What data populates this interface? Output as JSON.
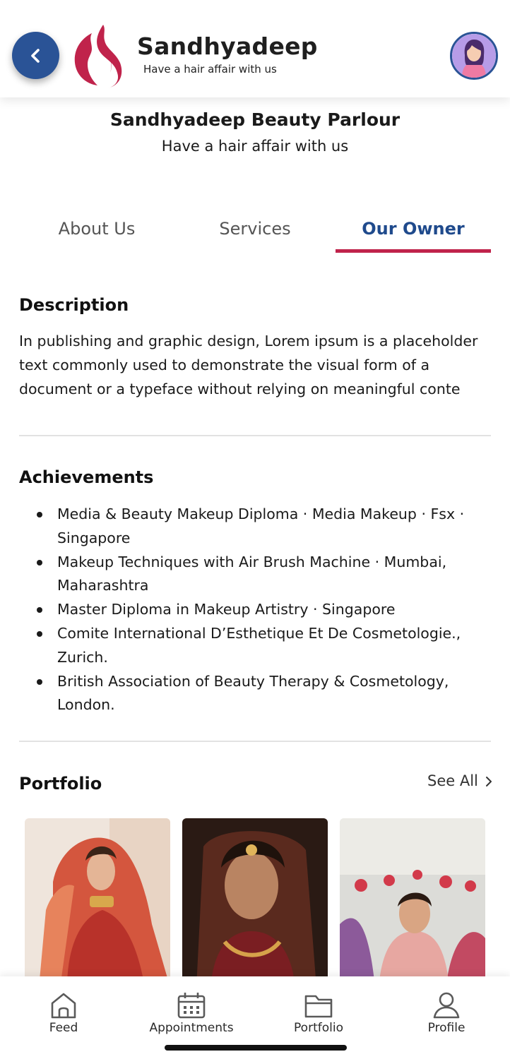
{
  "header": {
    "brand_name": "Sandhyadeep",
    "brand_tagline": "Have a hair affair with us",
    "accent_color": "#2a5396",
    "logo_color": "#c0234b"
  },
  "parlour": {
    "title": "Sandhyadeep Beauty Parlour",
    "subtitle": "Have a hair affair with us"
  },
  "tabs": [
    {
      "label": "About Us",
      "active": false
    },
    {
      "label": "Services",
      "active": false
    },
    {
      "label": "Our Owner",
      "active": true
    }
  ],
  "description": {
    "heading": "Description",
    "text": "In publishing and graphic design, Lorem ipsum is a placeholder text commonly used to demonstrate the visual form of a document or a typeface without relying on meaningful conte"
  },
  "achievements": {
    "heading": "Achievements",
    "items": [
      "Media & Beauty Makeup Diploma · Media Makeup · Fsx · Singapore",
      "Makeup Techniques with Air Brush Machine · Mumbai, Maharashtra",
      "Master Diploma in Makeup Artistry · Singapore",
      "Comite International D’Esthetique Et De Cosmetologie., Zurich.",
      "British Association of Beauty Therapy & Cosmetology, London."
    ]
  },
  "portfolio": {
    "heading": "Portfolio",
    "see_all": "See All"
  },
  "bottom_nav": [
    {
      "label": "Feed",
      "icon": "home-icon"
    },
    {
      "label": "Appointments",
      "icon": "calendar-icon"
    },
    {
      "label": "Portfolio",
      "icon": "folder-icon"
    },
    {
      "label": "Profile",
      "icon": "user-icon"
    }
  ]
}
